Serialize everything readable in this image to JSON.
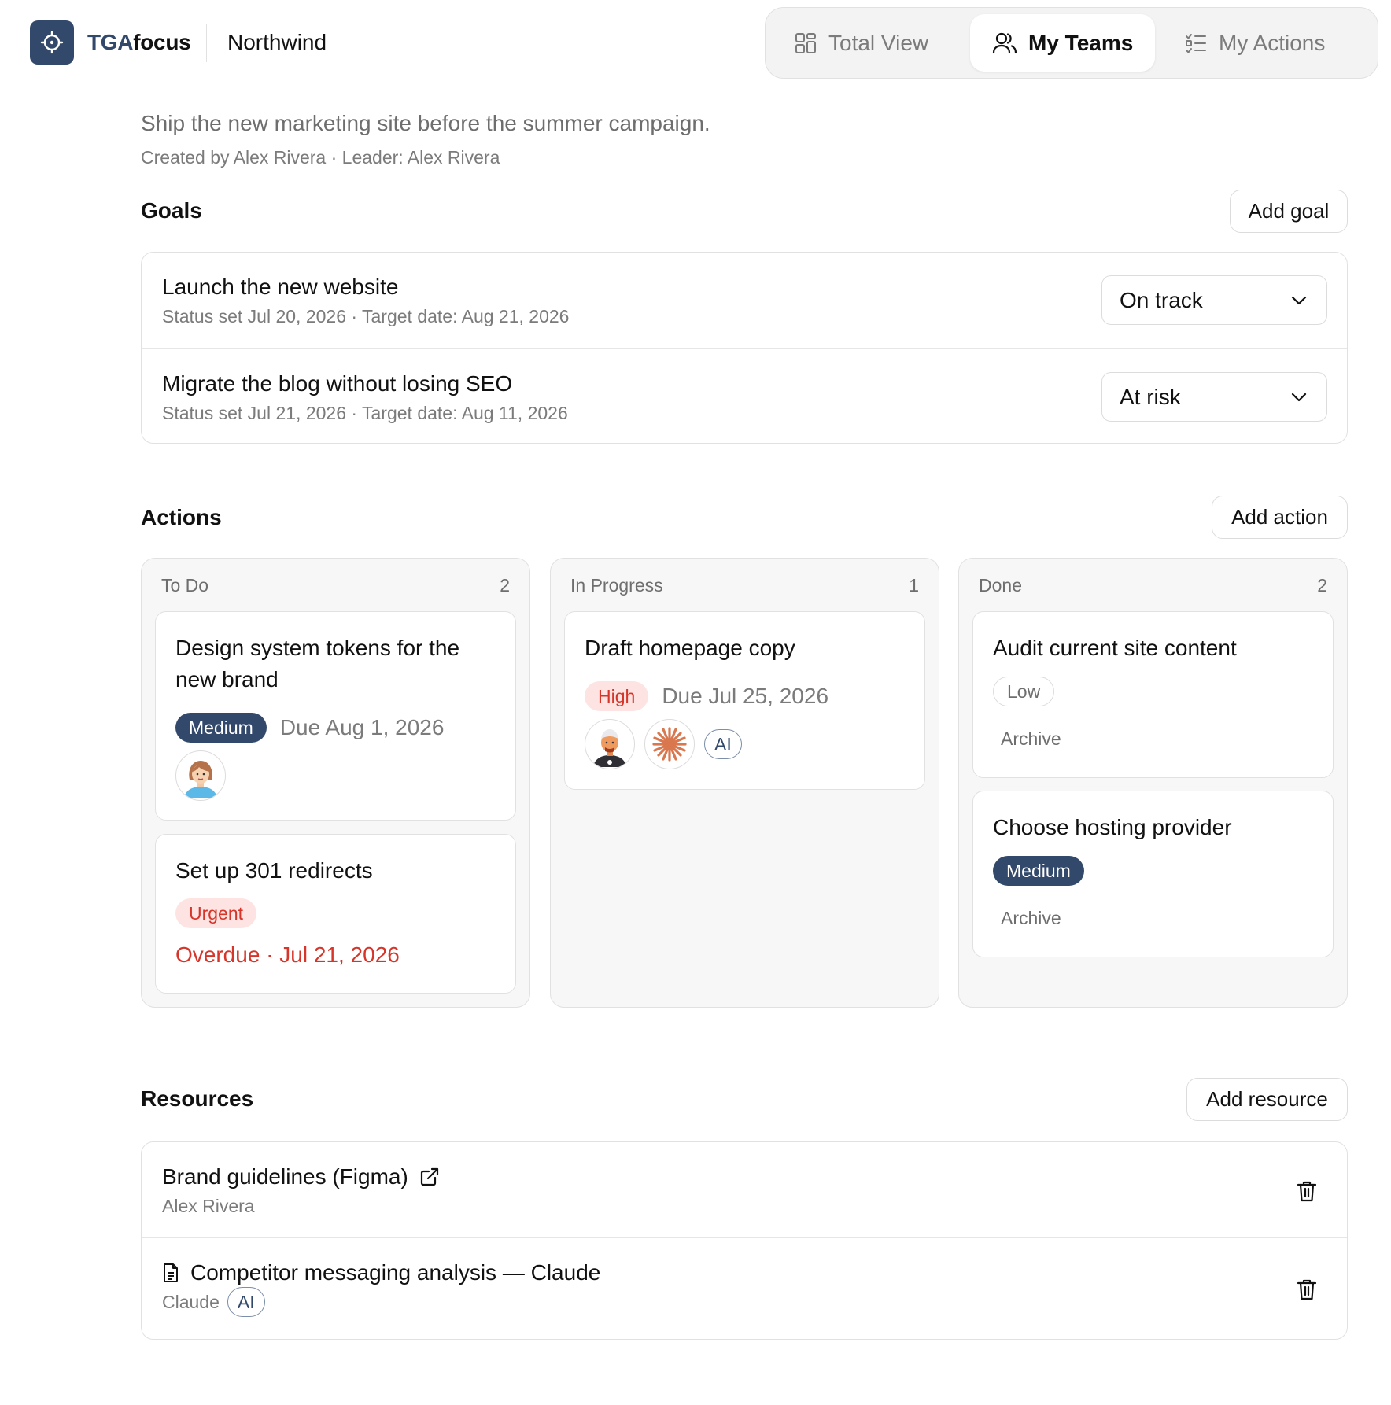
{
  "header": {
    "brand_part1": "TGA",
    "brand_part2": "focus",
    "org_name": "Northwind",
    "nav": [
      {
        "label": "Total View",
        "icon": "grid-icon",
        "active": false
      },
      {
        "label": "My Teams",
        "icon": "users-icon",
        "active": true
      },
      {
        "label": "My Actions",
        "icon": "checklist-icon",
        "active": false
      }
    ],
    "accent_color": "#32496b"
  },
  "team": {
    "description": "Ship the new marketing site before the summer campaign.",
    "meta": "Created by Alex Rivera · Leader: Alex Rivera"
  },
  "goals": {
    "title": "Goals",
    "add_label": "Add goal",
    "items": [
      {
        "title": "Launch the new website",
        "subtitle": "Status set Jul 20, 2026 · Target date: Aug 21, 2026",
        "status": "On track"
      },
      {
        "title": "Migrate the blog without losing SEO",
        "subtitle": "Status set Jul 21, 2026 · Target date: Aug 11, 2026",
        "status": "At risk"
      }
    ]
  },
  "actions": {
    "title": "Actions",
    "add_label": "Add action",
    "columns": [
      {
        "name": "To Do",
        "count": "2",
        "cards": [
          {
            "title": "Design system tokens for the new brand",
            "priority": "Medium",
            "due": "Due Aug 1, 2026",
            "avatars": [
              "woman-avatar-icon"
            ]
          },
          {
            "title": "Set up 301 redirects",
            "priority": "Urgent",
            "due": "Overdue · Jul 21, 2026"
          }
        ]
      },
      {
        "name": "In Progress",
        "count": "1",
        "cards": [
          {
            "title": "Draft homepage copy",
            "priority": "High",
            "due": "Due Jul 25, 2026",
            "avatars": [
              "man-avatar-icon",
              "claude-starburst-icon"
            ],
            "ai_badge": "AI"
          }
        ]
      },
      {
        "name": "Done",
        "count": "2",
        "cards": [
          {
            "title": "Audit current site content",
            "priority": "Low",
            "archive": "Archive"
          },
          {
            "title": "Choose hosting provider",
            "priority": "Medium",
            "archive": "Archive"
          }
        ]
      }
    ]
  },
  "resources": {
    "title": "Resources",
    "add_label": "Add resource",
    "items": [
      {
        "title": "Brand guidelines (Figma)",
        "icon": "external-link-icon",
        "owner": "Alex Rivera"
      },
      {
        "title": "Competitor messaging analysis — Claude",
        "icon": "document-icon",
        "owner": "Claude",
        "ai_badge": "AI"
      }
    ]
  },
  "colors": {
    "danger": "#d6352a",
    "danger_bg": "#fde4e2",
    "muted_text": "#7b7b7b",
    "border": "#e1e1e1"
  }
}
